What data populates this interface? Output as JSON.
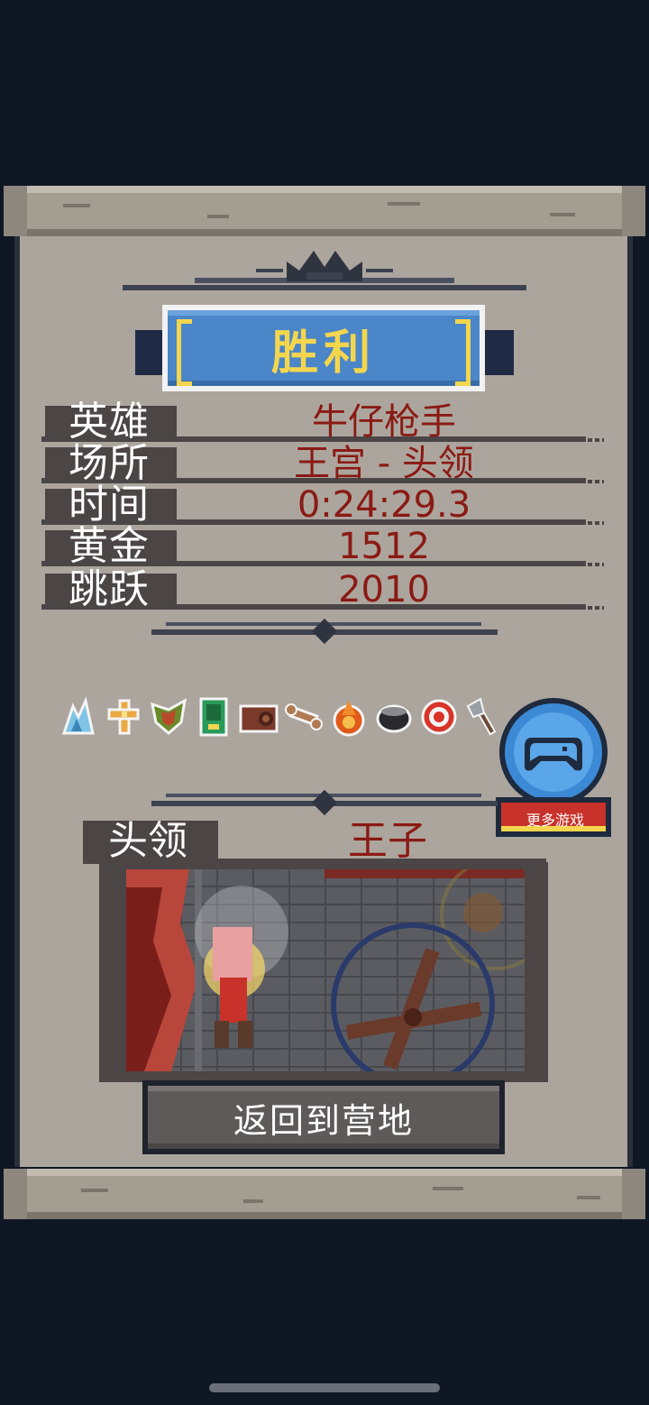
{
  "result": {
    "title": "胜利"
  },
  "stats": [
    {
      "label": "英雄",
      "value": "牛仔枪手"
    },
    {
      "label": "场所",
      "value": "王宫 - 头领"
    },
    {
      "label": "时间",
      "value": "0:24:29.3"
    },
    {
      "label": "黄金",
      "value": "1512"
    },
    {
      "label": "跳跃",
      "value": "2010"
    }
  ],
  "items": [
    {
      "icon": "crystal-icon"
    },
    {
      "icon": "holy-cross-icon"
    },
    {
      "icon": "leaf-armor-icon"
    },
    {
      "icon": "green-card-icon"
    },
    {
      "icon": "log-barrel-icon"
    },
    {
      "icon": "bone-icon"
    },
    {
      "icon": "fire-orb-icon"
    },
    {
      "icon": "cauldron-icon"
    },
    {
      "icon": "target-icon"
    },
    {
      "icon": "axe-icon"
    }
  ],
  "more_games": {
    "label": "更多游戏",
    "icon": "gamepad-icon"
  },
  "boss": {
    "label": "头领",
    "name": "王子"
  },
  "actions": {
    "return_label": "返回到营地"
  },
  "colors": {
    "background": "#0f1724",
    "parchment": "#aca59d",
    "banner_blue": "#4a86c8",
    "title_gold": "#f4d64e",
    "value_red": "#8a1a14"
  }
}
